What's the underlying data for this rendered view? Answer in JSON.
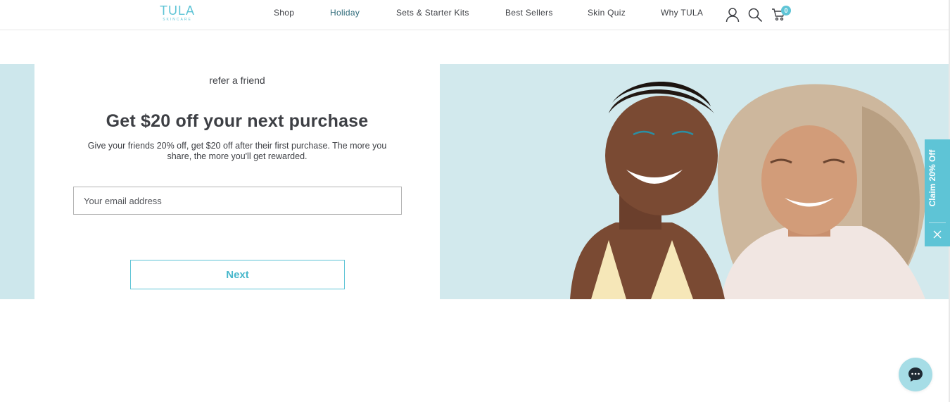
{
  "brand": {
    "name": "TULA",
    "tagline": "SKINCARE",
    "accent_color": "#5ec4d6"
  },
  "nav": {
    "items": [
      {
        "label": "Shop"
      },
      {
        "label": "Holiday"
      },
      {
        "label": "Sets & Starter Kits"
      },
      {
        "label": "Best Sellers"
      },
      {
        "label": "Skin Quiz"
      },
      {
        "label": "Why TULA"
      }
    ],
    "active_item": "Holiday",
    "icons": [
      "account-icon",
      "search-icon",
      "cart-icon"
    ],
    "cart_count": "0"
  },
  "hero": {
    "eyebrow": "refer a friend",
    "headline": "Get $20 off your next purchase",
    "subcopy": "Give your friends 20% off, get $20 off after their first purchase. The more you share, the more you'll get rewarded.",
    "email_placeholder": "Your email address",
    "email_value": "",
    "next_label": "Next",
    "background_color": "#cde7ec"
  },
  "claim_tab": {
    "label": "Claim 20% Off",
    "close_icon": "close-icon"
  },
  "chat": {
    "icon": "chat-bubble-icon"
  }
}
